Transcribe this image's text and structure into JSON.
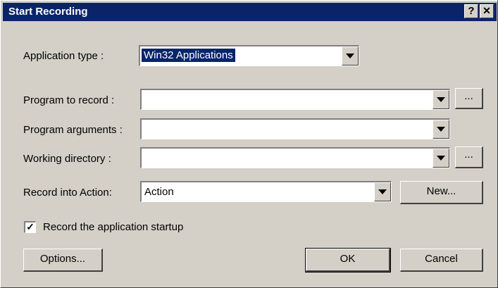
{
  "window": {
    "title": "Start Recording",
    "help_button": "?",
    "close_button": "✕"
  },
  "form": {
    "application_type": {
      "label": "Application type :",
      "value": "Win32 Applications"
    },
    "program_to_record": {
      "label": "Program to record :",
      "value": "",
      "browse": "..."
    },
    "program_arguments": {
      "label": "Program arguments :",
      "value": ""
    },
    "working_directory": {
      "label": "Working directory :",
      "value": "",
      "browse": "..."
    },
    "record_into_action": {
      "label": "Record into Action:",
      "value": "Action",
      "new_button": "New..."
    },
    "record_startup": {
      "label": "Record the application startup",
      "checked": true,
      "mark": "✓"
    }
  },
  "buttons": {
    "options": "Options...",
    "ok": "OK",
    "cancel": "Cancel"
  }
}
